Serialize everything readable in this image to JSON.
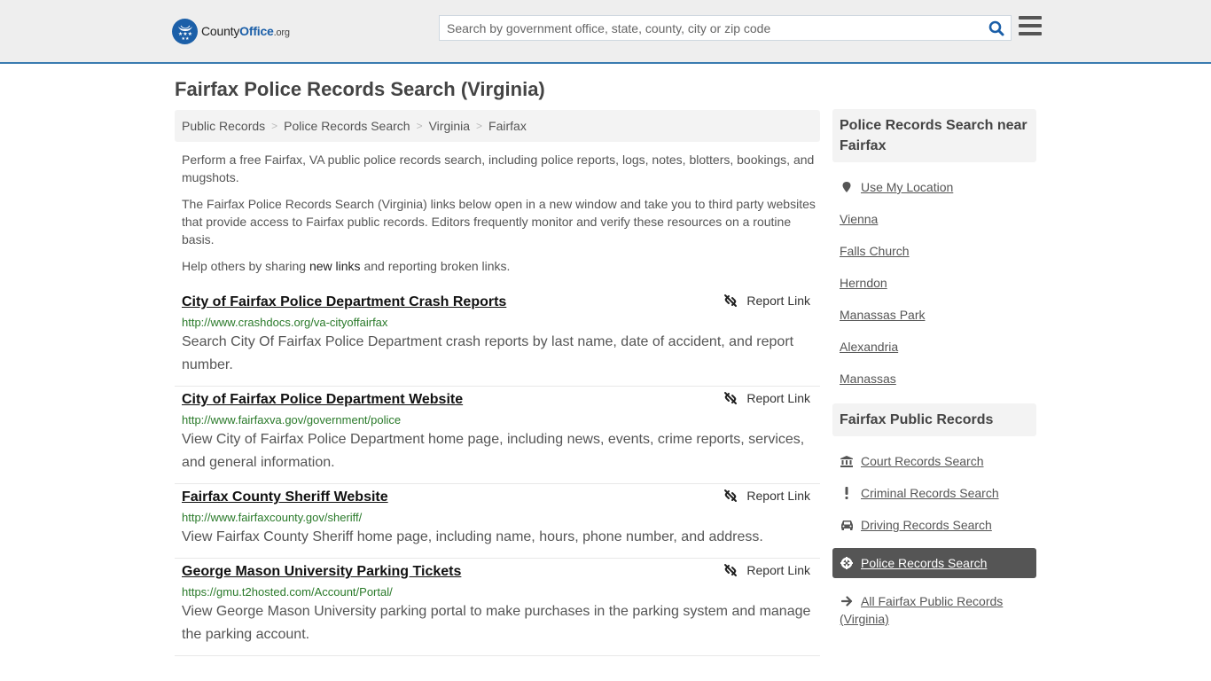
{
  "header": {
    "logo": {
      "name": "County",
      "highlight": "Office",
      "suffix": ".org"
    },
    "search": {
      "placeholder": "Search by government office, state, county, city or zip code",
      "value": ""
    },
    "icons": {
      "search": "search-icon",
      "menu": "hamburger-menu-icon"
    },
    "colors": {
      "brand": "#1b5fa8",
      "border": "#3a7bb0"
    }
  },
  "page": {
    "title": "Fairfax Police Records Search (Virginia)"
  },
  "breadcrumb": [
    {
      "label": "Public Records"
    },
    {
      "label": "Police Records Search"
    },
    {
      "label": "Virginia"
    },
    {
      "label": "Fairfax"
    }
  ],
  "breadcrumb_separator": ">",
  "intro": {
    "p1": "Perform a free Fairfax, VA public police records search, including police reports, logs, notes, blotters, bookings, and mugshots.",
    "p2": "The Fairfax Police Records Search (Virginia) links below open in a new window and take you to third party websites that provide access to Fairfax public records. Editors frequently monitor and verify these resources on a routine basis.",
    "p3_before": "Help others by sharing ",
    "p3_link": "new links",
    "p3_after": " and reporting broken links."
  },
  "results": [
    {
      "title": "City of Fairfax Police Department Crash Reports",
      "url": "http://www.crashdocs.org/va-cityoffairfax",
      "description": "Search City Of Fairfax Police Department crash reports by last name, date of accident, and report number.",
      "report_label": "Report Link"
    },
    {
      "title": "City of Fairfax Police Department Website",
      "url": "http://www.fairfaxva.gov/government/police",
      "description": "View City of Fairfax Police Department home page, including news, events, crime reports, services, and general information.",
      "report_label": "Report Link"
    },
    {
      "title": "Fairfax County Sheriff Website",
      "url": "http://www.fairfaxcounty.gov/sheriff/",
      "description": "View Fairfax County Sheriff home page, including name, hours, phone number, and address.",
      "report_label": "Report Link"
    },
    {
      "title": "George Mason University Parking Tickets",
      "url": "https://gmu.t2hosted.com/Account/Portal/",
      "description": "View George Mason University parking portal to make purchases in the parking system and manage the parking account.",
      "report_label": "Report Link"
    }
  ],
  "sidebar": {
    "nearby": {
      "heading": "Police Records Search near Fairfax",
      "use_location": "Use My Location",
      "cities": [
        "Vienna",
        "Falls Church",
        "Herndon",
        "Manassas Park",
        "Alexandria",
        "Manassas"
      ]
    },
    "public_records": {
      "heading": "Fairfax Public Records",
      "items": [
        {
          "label": "Court Records Search",
          "icon": "courthouse-icon",
          "active": false
        },
        {
          "label": "Criminal Records Search",
          "icon": "exclamation-icon",
          "active": false
        },
        {
          "label": "Driving Records Search",
          "icon": "car-icon",
          "active": false
        },
        {
          "label": "Police Records Search",
          "icon": "crosshair-icon",
          "active": true
        }
      ],
      "all_link": "All Fairfax Public Records (Virginia)"
    }
  }
}
